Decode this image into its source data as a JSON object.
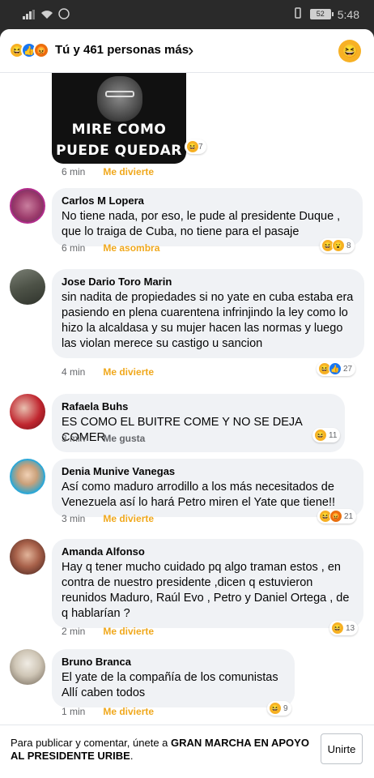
{
  "status_bar": {
    "battery": "52",
    "time": "5:48"
  },
  "header": {
    "summary": "Tú y 461 personas más"
  },
  "meme": {
    "line1": "MIRE COMO",
    "line2": "PUEDE QUEDAR",
    "reaction_count": "7",
    "time": "6 min",
    "action": "Me divierte"
  },
  "comments": [
    {
      "name": "Carlos M Lopera",
      "text": "No tiene nada, por eso, le pude al presidente Duque , que lo traiga de Cuba, no tiene para el pasaje",
      "time": "6 min",
      "action": "Me asombra",
      "count": "8",
      "reactions": [
        "haha",
        "wow"
      ]
    },
    {
      "name": "Jose Dario Toro Marin",
      "text": "sin nadita de propiedades si no yate en cuba estaba era pasiendo en plena cuarentena infrinjindo la ley como lo hizo la alcaldasa y su mujer hacen las normas y luego las violan merece su castigo u sancion",
      "time": "4 min",
      "action": "Me divierte",
      "count": "27",
      "reactions": [
        "haha",
        "like"
      ]
    },
    {
      "name": "Rafaela Buhs",
      "text": "ES COMO EL BUITRE COME Y NO SE DEJA COMER",
      "time": "3 min",
      "action": "Me gusta",
      "count": "11",
      "reactions": [
        "haha"
      ]
    },
    {
      "name": "Denia Munive Vanegas",
      "text": "Así como maduro arrodillo a los más necesitados de Venezuela así lo hará Petro miren el Yate que tiene!!",
      "time": "3 min",
      "action": "Me divierte",
      "count": "21",
      "reactions": [
        "haha",
        "angry"
      ]
    },
    {
      "name": "Amanda Alfonso",
      "text": "Hay q tener mucho cuidado pq algo traman estos , en contra de nuestro presidente ,dicen q estuvieron reunidos Maduro, Raúl Evo , Petro y Daniel Ortega , de q hablarían ?",
      "time": "2 min",
      "action": "Me divierte",
      "count": "13",
      "reactions": [
        "haha"
      ]
    },
    {
      "name": "Bruno Branca",
      "text": "El yate de la compañía de los comunistas Allí caben todos",
      "time": "1 min",
      "action": "Me divierte",
      "count": "9",
      "reactions": [
        "haha"
      ]
    }
  ],
  "footer": {
    "prefix": "Para publicar y comentar, únete a ",
    "group": "GRAN MARCHA EN APOYO AL PRESIDENTE URIBE",
    "suffix": ".",
    "button": "Unirte"
  },
  "colors": {
    "accent_action": "#f0a81c",
    "like_blue": "#1877f2",
    "haha_yellow": "#f7b125",
    "bubble_bg": "#f0f2f5"
  },
  "icons": {
    "reaction_haha": "😆",
    "reaction_like": "👍",
    "reaction_angry": "😡",
    "reaction_wow": "😮"
  }
}
